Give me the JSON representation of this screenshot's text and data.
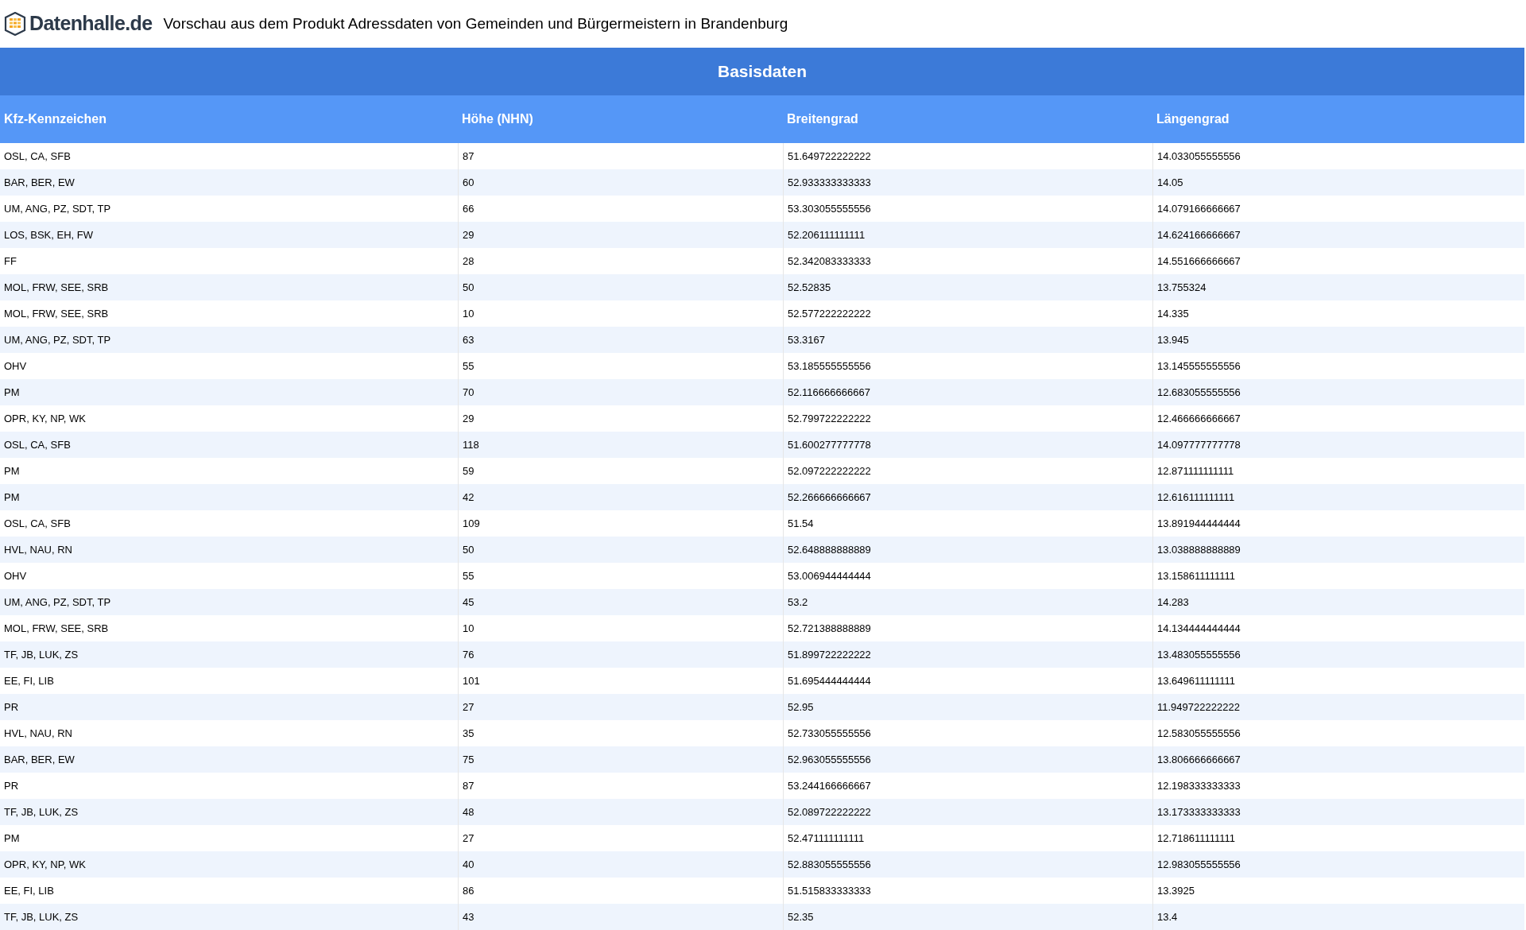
{
  "header": {
    "logo_text": "Datenhalle.de",
    "title": "Vorschau aus dem Produkt Adressdaten von Gemeinden und Bürgermeistern in Brandenburg"
  },
  "table": {
    "title": "Basisdaten",
    "columns": [
      "Kfz-Kennzeichen",
      "Höhe (NHN)",
      "Breitengrad",
      "Längengrad"
    ],
    "rows": [
      [
        "OSL, CA, SFB",
        "87",
        "51.649722222222",
        "14.033055555556"
      ],
      [
        "BAR, BER, EW",
        "60",
        "52.933333333333",
        "14.05"
      ],
      [
        "UM, ANG, PZ, SDT, TP",
        "66",
        "53.303055555556",
        "14.079166666667"
      ],
      [
        "LOS, BSK, EH, FW",
        "29",
        "52.206111111111",
        "14.624166666667"
      ],
      [
        "FF",
        "28",
        "52.342083333333",
        "14.551666666667"
      ],
      [
        "MOL, FRW, SEE, SRB",
        "50",
        "52.52835",
        "13.755324"
      ],
      [
        "MOL, FRW, SEE, SRB",
        "10",
        "52.577222222222",
        "14.335"
      ],
      [
        "UM, ANG, PZ, SDT, TP",
        "63",
        "53.3167",
        "13.945"
      ],
      [
        "OHV",
        "55",
        "53.185555555556",
        "13.145555555556"
      ],
      [
        "PM",
        "70",
        "52.116666666667",
        "12.683055555556"
      ],
      [
        "OPR, KY, NP, WK",
        "29",
        "52.799722222222",
        "12.466666666667"
      ],
      [
        "OSL, CA, SFB",
        "118",
        "51.600277777778",
        "14.097777777778"
      ],
      [
        "PM",
        "59",
        "52.097222222222",
        "12.871111111111"
      ],
      [
        "PM",
        "42",
        "52.266666666667",
        "12.616111111111"
      ],
      [
        "OSL, CA, SFB",
        "109",
        "51.54",
        "13.891944444444"
      ],
      [
        "HVL, NAU, RN",
        "50",
        "52.648888888889",
        "13.038888888889"
      ],
      [
        "OHV",
        "55",
        "53.006944444444",
        "13.158611111111"
      ],
      [
        "UM, ANG, PZ, SDT, TP",
        "45",
        "53.2",
        "14.283"
      ],
      [
        "MOL, FRW, SEE, SRB",
        "10",
        "52.721388888889",
        "14.134444444444"
      ],
      [
        "TF, JB, LUK, ZS",
        "76",
        "51.899722222222",
        "13.483055555556"
      ],
      [
        "EE, FI, LIB",
        "101",
        "51.695444444444",
        "13.649611111111"
      ],
      [
        "PR",
        "27",
        "52.95",
        "11.949722222222"
      ],
      [
        "HVL, NAU, RN",
        "35",
        "52.733055555556",
        "12.583055555556"
      ],
      [
        "BAR, BER, EW",
        "75",
        "52.963055555556",
        "13.806666666667"
      ],
      [
        "PR",
        "87",
        "53.244166666667",
        "12.198333333333"
      ],
      [
        "TF, JB, LUK, ZS",
        "48",
        "52.089722222222",
        "13.173333333333"
      ],
      [
        "PM",
        "27",
        "52.471111111111",
        "12.718611111111"
      ],
      [
        "OPR, KY, NP, WK",
        "40",
        "52.883055555556",
        "12.983055555556"
      ],
      [
        "EE, FI, LIB",
        "86",
        "51.515833333333",
        "13.3925"
      ],
      [
        "TF, JB, LUK, ZS",
        "43",
        "52.35",
        "13.4"
      ]
    ]
  }
}
